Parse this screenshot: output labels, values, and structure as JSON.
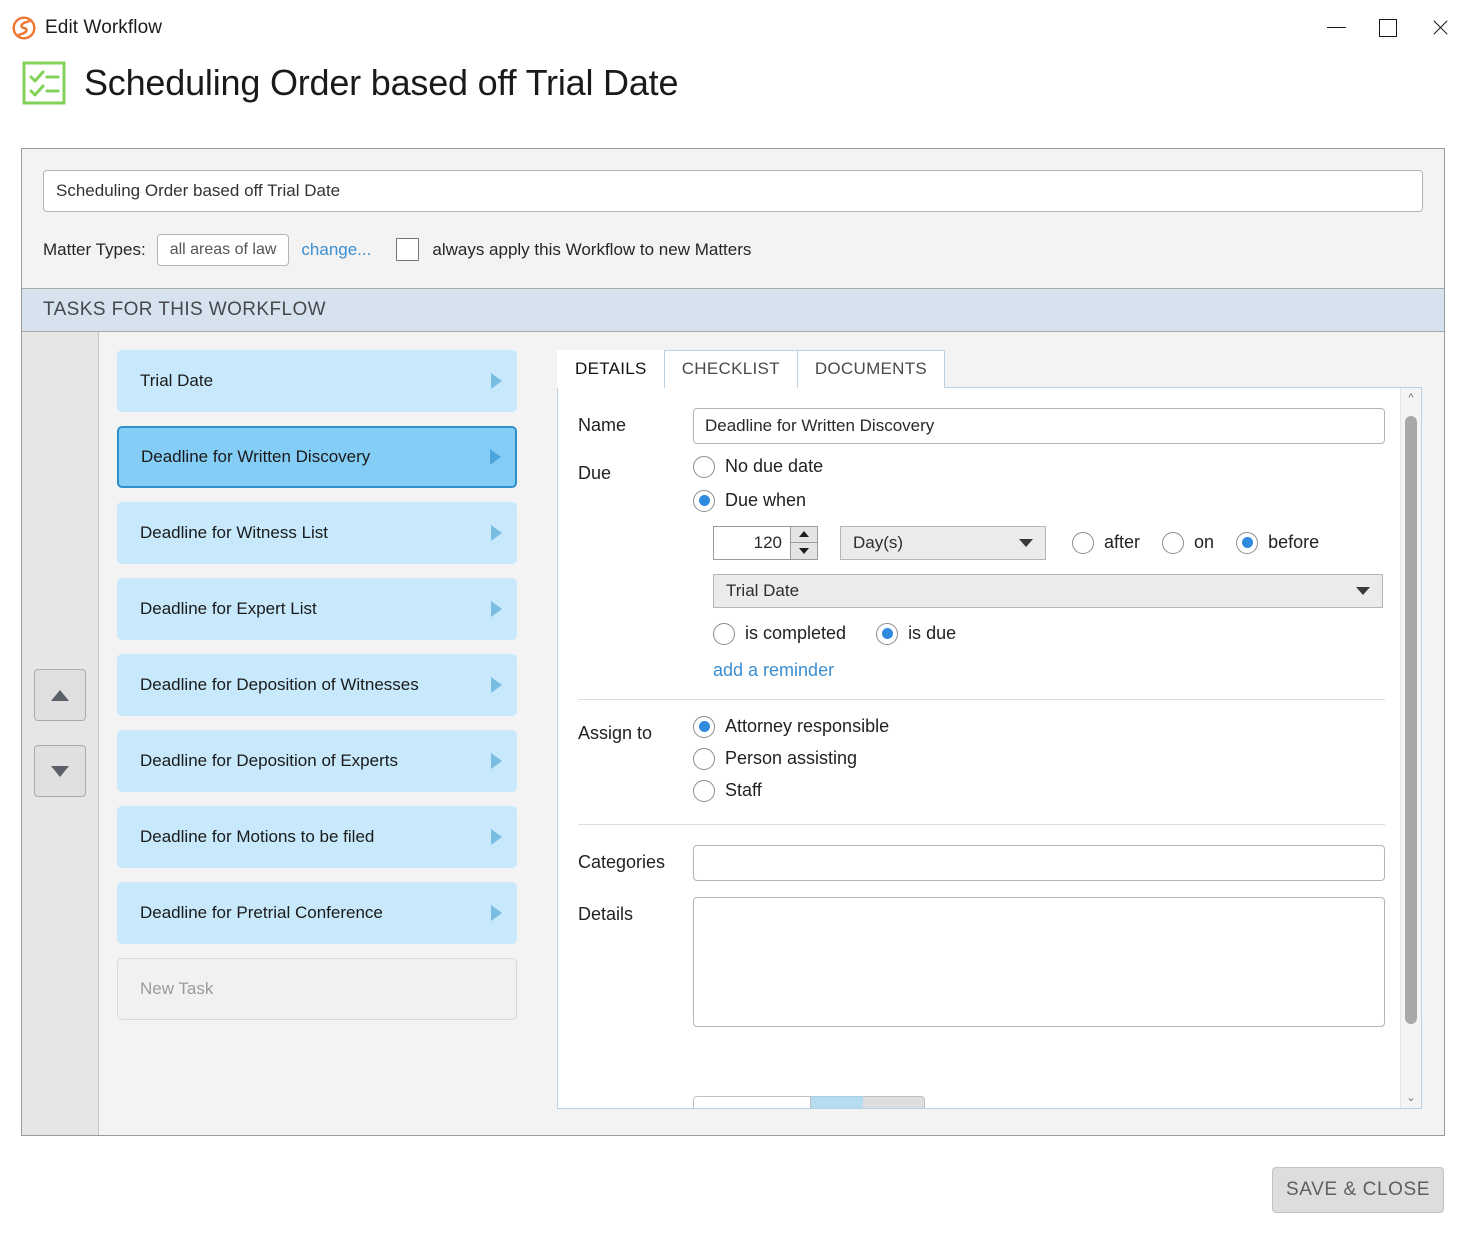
{
  "window": {
    "app_icon": "app-logo-icon",
    "title": "Edit Workflow",
    "minimize_label": "minimize",
    "maximize_label": "maximize",
    "close_label": "close"
  },
  "page": {
    "icon": "checklist-icon",
    "title": "Scheduling Order based off Trial Date"
  },
  "form": {
    "workflow_name": "Scheduling Order based off Trial Date",
    "workflow_name_placeholder": "Workflow name",
    "matter_types_label": "Matter Types:",
    "matter_types_value": "all areas of law",
    "change_link": "change...",
    "always_apply_label": "always apply this Workflow to new Matters",
    "always_apply_checked": false
  },
  "section": {
    "tasks_header": "TASKS FOR THIS WORKFLOW"
  },
  "reorder": {
    "move_up": "move up",
    "move_down": "move down"
  },
  "tasks": [
    {
      "label": "Trial Date",
      "selected": false
    },
    {
      "label": "Deadline for Written Discovery",
      "selected": true
    },
    {
      "label": "Deadline for Witness List",
      "selected": false
    },
    {
      "label": "Deadline for Expert List",
      "selected": false
    },
    {
      "label": "Deadline for Deposition of Witnesses",
      "selected": false
    },
    {
      "label": "Deadline for Deposition of Experts",
      "selected": false
    },
    {
      "label": "Deadline for Motions to be filed",
      "selected": false
    },
    {
      "label": "Deadline for Pretrial Conference",
      "selected": false
    },
    {
      "label": "New Task",
      "selected": false,
      "placeholder": true
    }
  ],
  "detail": {
    "tabs": [
      {
        "label": "DETAILS",
        "active": true
      },
      {
        "label": "CHECKLIST",
        "active": false
      },
      {
        "label": "DOCUMENTS",
        "active": false
      }
    ],
    "name_label": "Name",
    "name_value": "Deadline for Written Discovery",
    "due_label": "Due",
    "no_due_date_label": "No due date",
    "no_due_date_selected": false,
    "due_when_label": "Due when",
    "due_when_selected": true,
    "offset_value": "120",
    "unit_value": "Day(s)",
    "relation_options": [
      {
        "label": "after",
        "selected": false
      },
      {
        "label": "on",
        "selected": false
      },
      {
        "label": "before",
        "selected": true
      }
    ],
    "anchor_value": "Trial Date",
    "state_options": [
      {
        "label": "is completed",
        "selected": false
      },
      {
        "label": "is due",
        "selected": true
      }
    ],
    "add_reminder_link": "add a reminder",
    "assign_to_label": "Assign to",
    "assign_options": [
      {
        "label": "Attorney responsible",
        "selected": true
      },
      {
        "label": "Person assisting",
        "selected": false
      },
      {
        "label": "Staff",
        "selected": false
      }
    ],
    "categories_label": "Categories",
    "categories_value": "",
    "categories_placeholder": "",
    "details_label": "Details",
    "details_value": "",
    "details_placeholder": ""
  },
  "footer": {
    "save_close_label": "SAVE & CLOSE"
  },
  "colors": {
    "accent_blue": "#2f8ae0",
    "link_blue": "#3b8ed0",
    "task_fill": "#c7e9fb",
    "task_selected_fill": "#84cdf6",
    "task_selected_border": "#2f8fcb",
    "section_header": "#d6e3ef",
    "logo_orange": "#ee7733",
    "checklist_green": "#82d159"
  }
}
